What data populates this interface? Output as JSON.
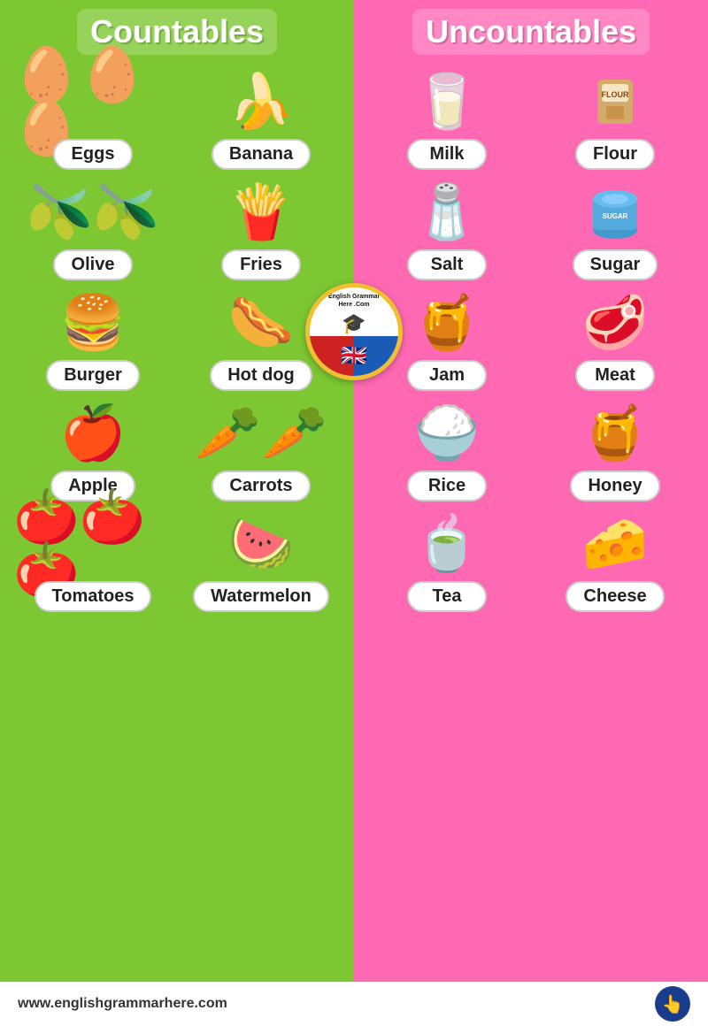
{
  "countables": {
    "title": "Countables",
    "items": [
      {
        "label": "Eggs",
        "emoji": "🥚🥚🥚"
      },
      {
        "label": "Banana",
        "emoji": "🍌"
      },
      {
        "label": "Olive",
        "emoji": "🫒"
      },
      {
        "label": "Fries",
        "emoji": "🍟"
      },
      {
        "label": "Burger",
        "emoji": "🍔"
      },
      {
        "label": "Hot dog",
        "emoji": "🌭"
      },
      {
        "label": "Apple",
        "emoji": "🍎"
      },
      {
        "label": "Carrots",
        "emoji": "🥕🥕"
      },
      {
        "label": "Tomatoes",
        "emoji": "🍅🍅🍅"
      },
      {
        "label": "Watermelon",
        "emoji": "🍉"
      }
    ]
  },
  "uncountables": {
    "title": "Uncountables",
    "items": [
      {
        "label": "Milk",
        "emoji": "🥛"
      },
      {
        "label": "Flour",
        "emoji": "🏷️"
      },
      {
        "label": "Salt",
        "emoji": "🧂"
      },
      {
        "label": "Sugar",
        "emoji": "🫙"
      },
      {
        "label": "Jam",
        "emoji": "🍯"
      },
      {
        "label": "Meat",
        "emoji": "🥩"
      },
      {
        "label": "Rice",
        "emoji": "🍚"
      },
      {
        "label": "Honey",
        "emoji": "🍯"
      },
      {
        "label": "Tea",
        "emoji": "🍵"
      },
      {
        "label": "Cheese",
        "emoji": "🧀"
      }
    ]
  },
  "footer": {
    "website": "www.englishgrammarhere.com"
  },
  "badge": {
    "text": "English Grammar Here .Com"
  }
}
